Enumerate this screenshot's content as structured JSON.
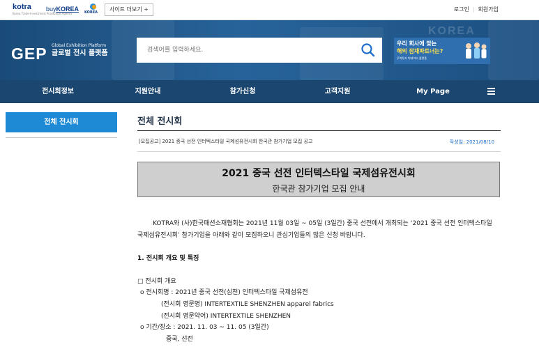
{
  "topbar": {
    "kotra_logo": "kotra",
    "kotra_sub": "Korea Trade-Investment Promotion Agency",
    "buykorea_logo_prefix": "buy",
    "buykorea_logo_main": "KOREA",
    "investkorea_logo": "KOREA",
    "site_more": "사이트 더보기 +",
    "login": "로그인",
    "signup": "회원가입"
  },
  "header": {
    "logo": "GEP",
    "logo_en": "Global Exhibition Platform",
    "logo_ko": "글로벌 전시 플랫폼",
    "search_placeholder": "검색어를 입력하세요.",
    "banner_line1": "우리 회사에 맞는",
    "banner_line2": "해외 잠재파트너는?",
    "banner_line3": "무역투자 빅데이터 플랫폼",
    "banner_bg_text": "KOREA"
  },
  "nav": {
    "items": [
      "전시회정보",
      "지원안내",
      "참가신청",
      "고객지원",
      "My Page"
    ]
  },
  "sidebar": {
    "active": "전체 전시회"
  },
  "main": {
    "page_title": "전체 전시회",
    "post_title": "[모집공고] 2021 중국 선전 인터텍스타일 국제섬유전시회 한국관 참가기업 모집 공고",
    "post_date": "작성일: 2021/08/10",
    "box_title": "2021 중국 선전 인터텍스타일 국제섬유전시회",
    "box_subtitle": "한국관 참가기업 모집 안내",
    "paragraph": "KOTRA와 (사)한국패션소재협회는 2021년 11월 03일 ~ 05일 (3일간) 중국 선전에서 개최되는 ‘2021 중국 선전 인터텍스타일 국제섬유전시회’ 참가기업을 아래와 같이 모집하오니 관심기업들의 많은 신청 바랍니다.",
    "section1": "1. 전시회 개요 및 특징",
    "lines": [
      "□ 전시회 개요",
      "o 전시회명 : 2021년 중국 선전(심천) 인터텍스타일 국제섬유전",
      "(전시회 영문명) INTERTEXTILE SHENZHEN apparel fabrics",
      "(전시회 영문약어) INTERTEXTILE SHENZHEN",
      "o 기간/장소 : 2021. 11. 03 ~ 11. 05 (3일간)",
      "중국, 선전"
    ]
  },
  "colors": {
    "nav_bg": "#1b466f",
    "accent_blue": "#1e8ad6",
    "date_blue": "#1e6fc9"
  }
}
